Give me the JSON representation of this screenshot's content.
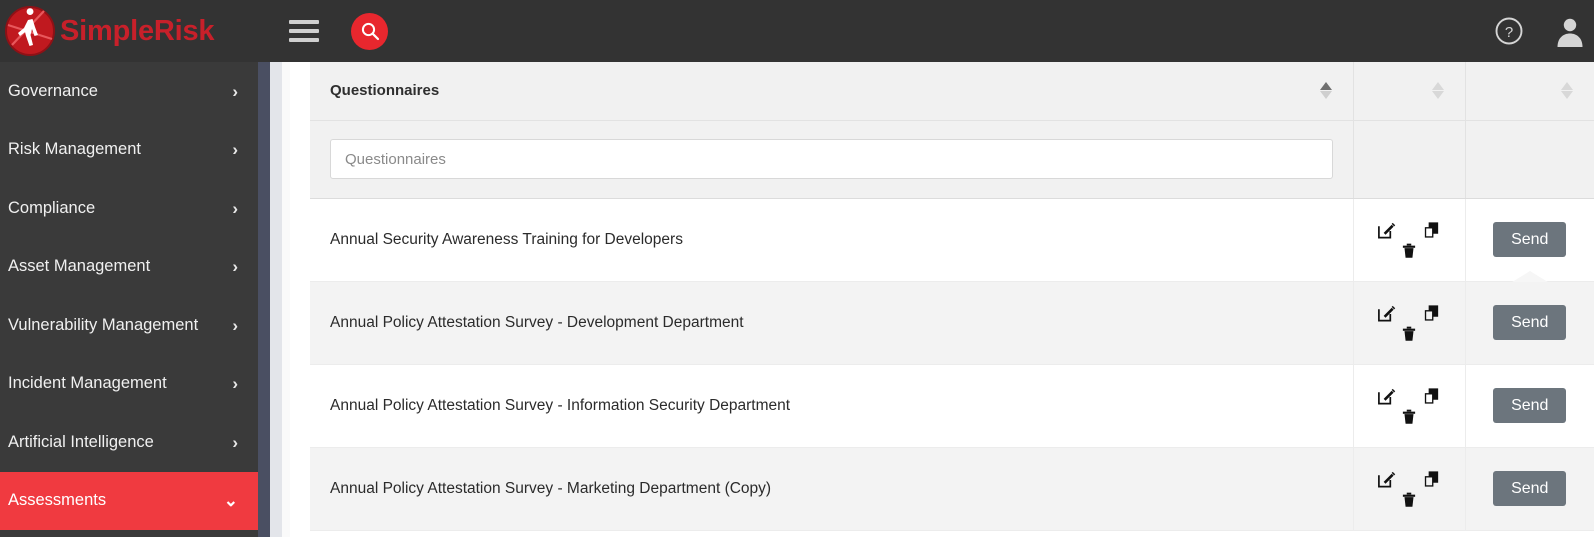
{
  "brand": {
    "name_simple": "Simple",
    "name_risk": "Risk",
    "logo_icon": "simplerisk-logo-icon"
  },
  "topbar": {
    "menu_icon": "hamburger-menu-icon",
    "search_icon": "search-icon",
    "help_icon": "help-circle-icon",
    "user_icon": "user-avatar-icon",
    "background_color": "#333333",
    "search_button_color": "#e8272e"
  },
  "sidebar": {
    "background_color": "#3a3a3a",
    "active_color": "#f03a40",
    "items": [
      {
        "label": "Governance",
        "icon": "chevron-right-icon",
        "active": false
      },
      {
        "label": "Risk Management",
        "icon": "chevron-right-icon",
        "active": false
      },
      {
        "label": "Compliance",
        "icon": "chevron-right-icon",
        "active": false
      },
      {
        "label": "Asset Management",
        "icon": "chevron-right-icon",
        "active": false
      },
      {
        "label": "Vulnerability Management",
        "icon": "chevron-right-icon",
        "active": false
      },
      {
        "label": "Incident Management",
        "icon": "chevron-right-icon",
        "active": false
      },
      {
        "label": "Artificial Intelligence",
        "icon": "chevron-right-icon",
        "active": false
      },
      {
        "label": "Assessments",
        "icon": "chevron-down-icon",
        "active": true
      }
    ]
  },
  "table": {
    "header": {
      "title": "Questionnaires",
      "sort_main": "ascending",
      "sort_actions": "none",
      "sort_send": "none"
    },
    "filter": {
      "placeholder": "Questionnaires",
      "value": ""
    },
    "send_label": "Send",
    "send_button_color": "#6c757d",
    "action_icons": {
      "edit": "edit-pencil-icon",
      "copy": "copy-duplicate-icon",
      "delete": "trash-delete-icon"
    },
    "rows": [
      {
        "name": "Annual Security Awareness Training for Developers"
      },
      {
        "name": "Annual Policy Attestation Survey - Development Department"
      },
      {
        "name": "Annual Policy Attestation Survey - Information Security Department"
      },
      {
        "name": "Annual Policy Attestation Survey - Marketing Department (Copy)"
      }
    ]
  }
}
